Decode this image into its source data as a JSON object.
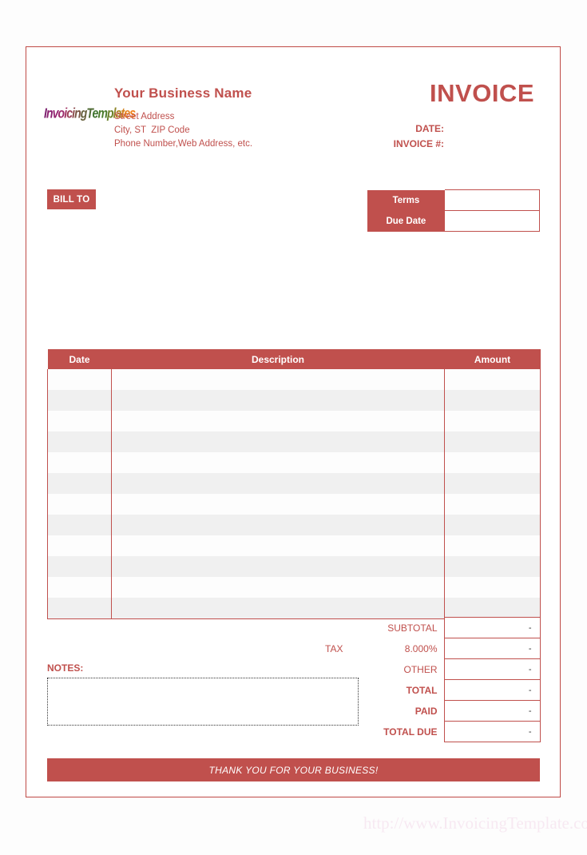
{
  "theme": {
    "accent": "#c0504d",
    "accent_border": "#bf4a46",
    "row_alt": "#f0f0f0",
    "page_bg": "#ffffff"
  },
  "header": {
    "logo": {
      "name": "invoicing-templates-logo",
      "text": "InvoicingTemplates",
      "letters": [
        {
          "ch": "I",
          "color": "#7b1f6e"
        },
        {
          "ch": "n",
          "color": "#8a2070"
        },
        {
          "ch": "v",
          "color": "#93216f"
        },
        {
          "ch": "o",
          "color": "#9c2a6b"
        },
        {
          "ch": "i",
          "color": "#a23363"
        },
        {
          "ch": "c",
          "color": "#9a3f57"
        },
        {
          "ch": "i",
          "color": "#8c4b4c"
        },
        {
          "ch": "n",
          "color": "#7a5544"
        },
        {
          "ch": "g",
          "color": "#67603c"
        },
        {
          "ch": "T",
          "color": "#4e6a33"
        },
        {
          "ch": "e",
          "color": "#3f7430"
        },
        {
          "ch": "m",
          "color": "#4a7a2c"
        },
        {
          "ch": "p",
          "color": "#6a812a"
        },
        {
          "ch": "l",
          "color": "#8e8526"
        },
        {
          "ch": "a",
          "color": "#b08522"
        },
        {
          "ch": "t",
          "color": "#d3821e"
        },
        {
          "ch": "e",
          "color": "#e8801c"
        },
        {
          "ch": "s",
          "color": "#f07f1a"
        }
      ]
    },
    "business_name": "Your Business Name",
    "address_lines": [
      "Street Address",
      "City, ST  ZIP Code",
      "Phone Number,Web Address, etc."
    ],
    "invoice_title": "INVOICE",
    "meta": [
      {
        "label": "DATE:",
        "value": ""
      },
      {
        "label": "INVOICE #:",
        "value": ""
      }
    ]
  },
  "bill_to": {
    "badge_label": "BILL TO",
    "value": ""
  },
  "terms": {
    "rows": [
      {
        "label": "Terms",
        "value": ""
      },
      {
        "label": "Due Date",
        "value": ""
      }
    ]
  },
  "items": {
    "columns": [
      "Date",
      "Description",
      "Amount"
    ],
    "rows": [
      {
        "date": "",
        "description": "",
        "amount": ""
      },
      {
        "date": "",
        "description": "",
        "amount": ""
      },
      {
        "date": "",
        "description": "",
        "amount": ""
      },
      {
        "date": "",
        "description": "",
        "amount": ""
      },
      {
        "date": "",
        "description": "",
        "amount": ""
      },
      {
        "date": "",
        "description": "",
        "amount": ""
      },
      {
        "date": "",
        "description": "",
        "amount": ""
      },
      {
        "date": "",
        "description": "",
        "amount": ""
      },
      {
        "date": "",
        "description": "",
        "amount": ""
      },
      {
        "date": "",
        "description": "",
        "amount": ""
      },
      {
        "date": "",
        "description": "",
        "amount": ""
      },
      {
        "date": "",
        "description": "",
        "amount": ""
      }
    ]
  },
  "notes": {
    "label": "NOTES:",
    "value": ""
  },
  "totals": {
    "rows": [
      {
        "tag": "",
        "label": "SUBTOTAL",
        "value": "-",
        "bold": false
      },
      {
        "tag": "TAX",
        "label": "8.000%",
        "value": "-",
        "bold": false
      },
      {
        "tag": "",
        "label": "OTHER",
        "value": "-",
        "bold": false
      },
      {
        "tag": "",
        "label": "TOTAL",
        "value": "-",
        "bold": true
      },
      {
        "tag": "",
        "label": "PAID",
        "value": "-",
        "bold": true
      },
      {
        "tag": "",
        "label": "TOTAL DUE",
        "value": "-",
        "bold": true
      }
    ]
  },
  "footer": {
    "thanks": "THANK YOU FOR YOUR BUSINESS!",
    "watermark": "http://www.InvoicingTemplate.com"
  }
}
